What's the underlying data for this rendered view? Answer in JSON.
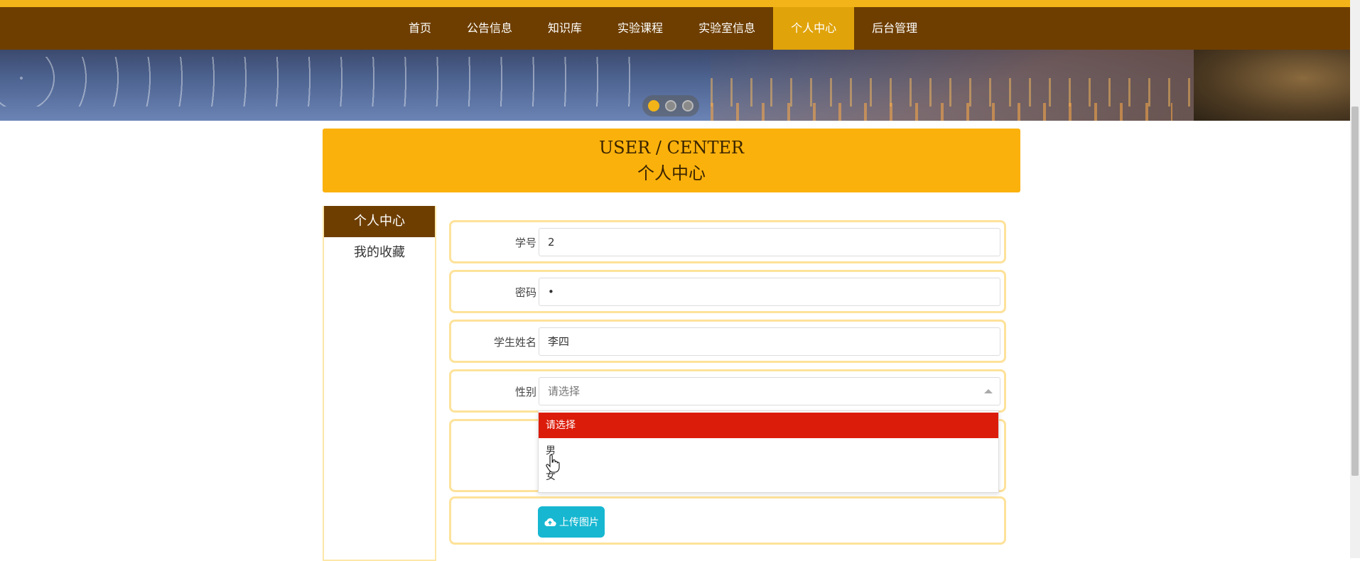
{
  "nav": {
    "items": [
      {
        "label": "首页"
      },
      {
        "label": "公告信息"
      },
      {
        "label": "知识库"
      },
      {
        "label": "实验课程"
      },
      {
        "label": "实验室信息"
      },
      {
        "label": "个人中心"
      },
      {
        "label": "后台管理"
      }
    ],
    "active": "个人中心"
  },
  "banner": {
    "slide_count": 3,
    "active_slide": 1
  },
  "header": {
    "title_en": "USER / CENTER",
    "title_zh": "个人中心"
  },
  "sidebar": {
    "items": [
      {
        "label": "个人中心"
      },
      {
        "label": "我的收藏"
      }
    ]
  },
  "form": {
    "student_id": {
      "label": "学号",
      "value": "2"
    },
    "password": {
      "label": "密码",
      "value": "•"
    },
    "student_name": {
      "label": "学生姓名",
      "value": "李四"
    },
    "gender": {
      "label": "性别",
      "selected": "请选择",
      "options": [
        "请选择",
        "男",
        "女"
      ]
    },
    "upload_label": "上传图片"
  },
  "colors": {
    "nav_bg": "#6e3e00",
    "nav_active": "#e0a30a",
    "header_bg": "#fbb10c",
    "dropdown_selected": "#dc1c0a",
    "upload_button": "#17b7d1"
  }
}
